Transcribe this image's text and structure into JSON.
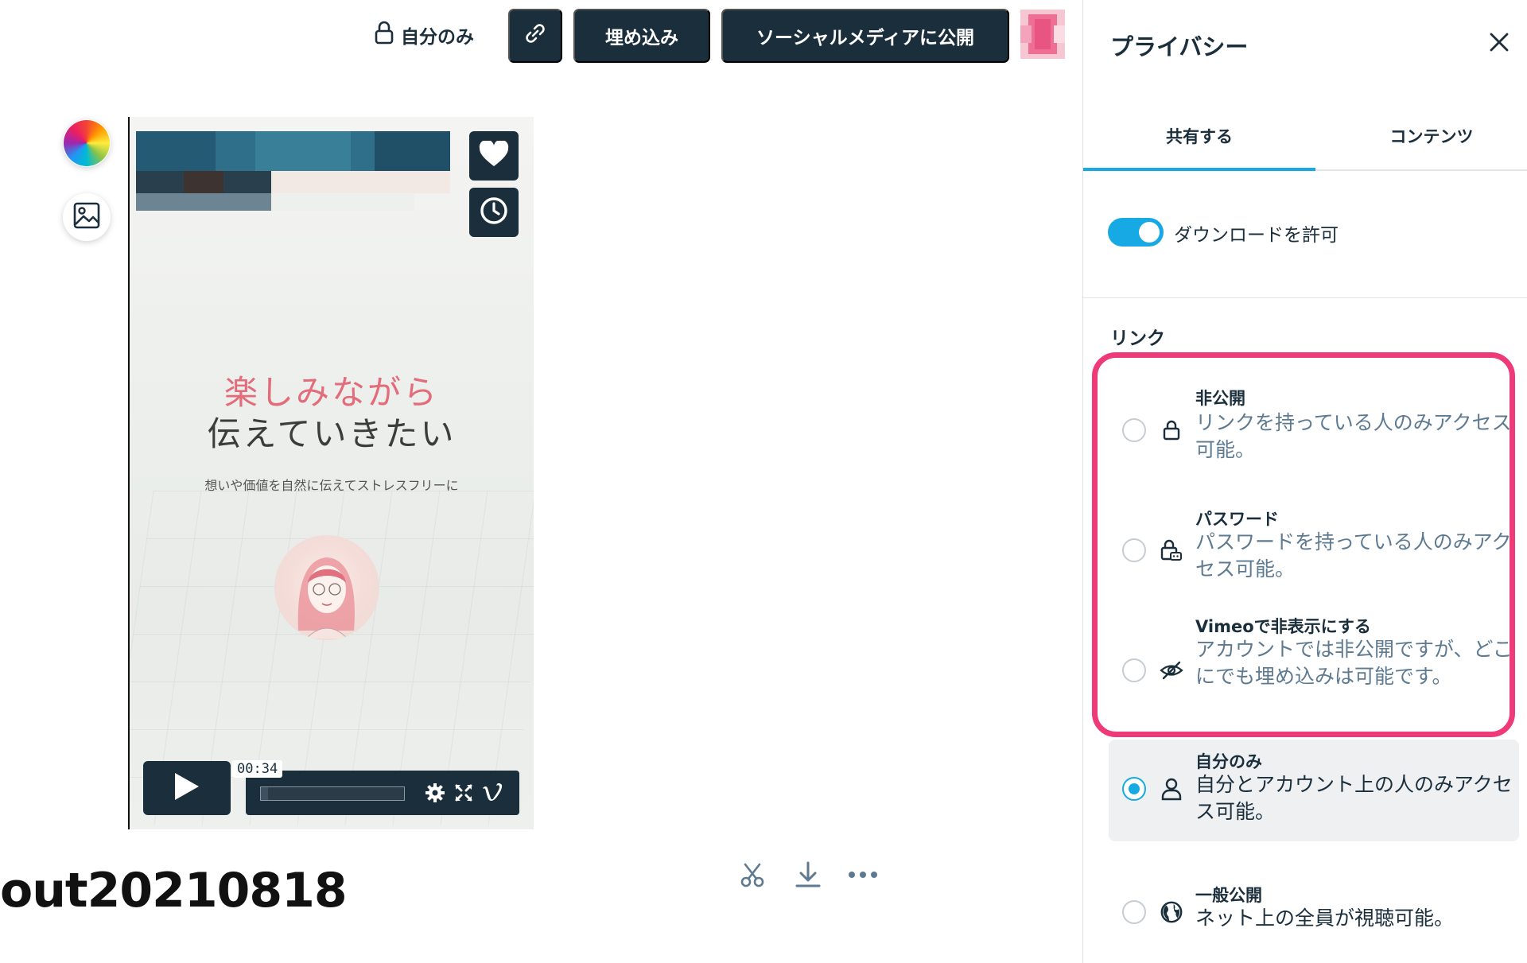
{
  "toolbar": {
    "privacy_status": "自分のみ",
    "embed_label": "埋め込み",
    "social_label": "ソーシャルメディアに公開"
  },
  "video": {
    "heading_line1": "楽しみながら",
    "heading_line2": "伝えていきたい",
    "subtext": "想いや価値を自然に伝えてストレスフリーに",
    "time": "00:34",
    "progress": 0.05,
    "title": "out20210818"
  },
  "panel": {
    "title": "プライバシー",
    "tabs": [
      {
        "label": "共有する",
        "active": true
      },
      {
        "label": "コンテンツ",
        "active": false
      }
    ],
    "download_label": "ダウンロードを許可",
    "download_enabled": true,
    "section_link": "リンク",
    "options": [
      {
        "id": "private",
        "title": "非公開",
        "desc": "リンクを持っている人のみアクセス可能。",
        "icon": "lock-icon",
        "selected": false
      },
      {
        "id": "password",
        "title": "パスワード",
        "desc": "パスワードを持っている人のみアクセス可能。",
        "icon": "password-lock-icon",
        "selected": false
      },
      {
        "id": "hidden",
        "title": "Vimeoで非表示にする",
        "desc": "アカウントでは非公開ですが、どこにでも埋め込みは可能です。",
        "icon": "eye-off-icon",
        "selected": false
      },
      {
        "id": "only-me",
        "title": "自分のみ",
        "desc": "自分とアカウント上の人のみアクセス可能。",
        "icon": "person-icon",
        "selected": true
      },
      {
        "id": "public",
        "title": "一般公開",
        "desc": "ネット上の全員が視聴可能。",
        "icon": "globe-icon",
        "selected": false
      }
    ]
  },
  "colors": {
    "accent": "#17a9e3",
    "dark": "#1a2e3b",
    "highlight": "#ee3a78",
    "heading_pink": "#e36b7a"
  }
}
